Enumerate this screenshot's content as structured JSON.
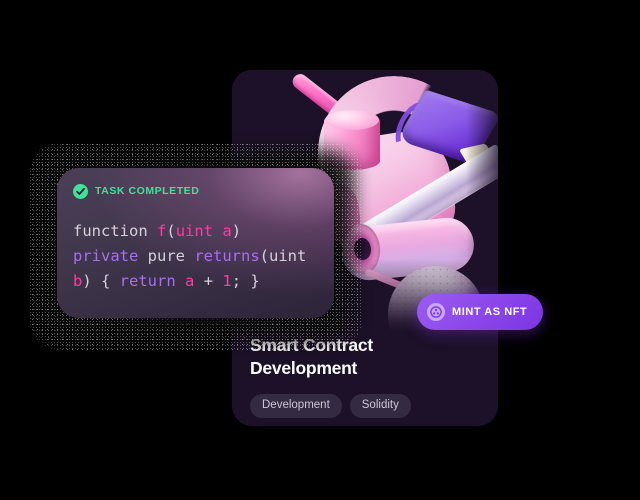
{
  "card": {
    "title": "Smart Contract\nDevelopment",
    "tags": [
      {
        "label": "Development"
      },
      {
        "label": "Solidity"
      }
    ],
    "background_color": "#1c1128"
  },
  "mint_button": {
    "label": "MINT AS NFT",
    "icon": "nft-token-icon",
    "accent_color": "#8b45ea"
  },
  "code_panel": {
    "status": {
      "label": "TASK COMPLETED",
      "icon": "check-circle-icon",
      "color": "#3ee398"
    },
    "code_lines": [
      {
        "tokens": [
          {
            "text": "function ",
            "type": "plain"
          },
          {
            "text": "f",
            "type": "name"
          },
          {
            "text": "(",
            "type": "punct"
          },
          {
            "text": "uint a",
            "type": "name"
          },
          {
            "text": ")",
            "type": "punct"
          }
        ]
      },
      {
        "tokens": [
          {
            "text": "private ",
            "type": "keyword"
          },
          {
            "text": "pure ",
            "type": "plain"
          },
          {
            "text": "returns",
            "type": "keyword"
          },
          {
            "text": "(",
            "type": "punct"
          },
          {
            "text": "uint",
            "type": "plain"
          }
        ]
      },
      {
        "tokens": [
          {
            "text": "b",
            "type": "var"
          },
          {
            "text": ") { ",
            "type": "punct"
          },
          {
            "text": "return",
            "type": "keyword"
          },
          {
            "text": " ",
            "type": "plain"
          },
          {
            "text": "a",
            "type": "var"
          },
          {
            "text": " + ",
            "type": "punct"
          },
          {
            "text": "1",
            "type": "number"
          },
          {
            "text": "; }",
            "type": "punct"
          }
        ]
      }
    ],
    "syntax_colors": {
      "plain": "#d6d0dc",
      "name": "#ff3ba0",
      "keyword": "#a86ef0",
      "punct": "#d6d0dc",
      "number": "#ff3ba0",
      "var": "#ff3ba0"
    }
  },
  "illustration": {
    "name": "abstract-3d-shapes",
    "description": "Abstract 3D render of pink, lavender and violet geometric shapes",
    "shapes": [
      "pink-capsule",
      "pale-pink-arc",
      "pink-cylinder",
      "pink-slab",
      "violet-wedge",
      "metallic-silver-bar",
      "pink-rod",
      "hollow-pink-tube",
      "textured-sphere-planet"
    ]
  }
}
